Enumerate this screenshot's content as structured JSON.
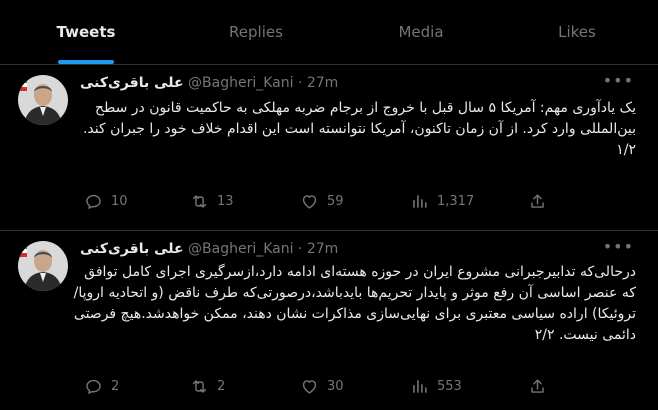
{
  "tabs": [
    {
      "label": "Tweets",
      "active": true
    },
    {
      "label": "Replies",
      "active": false
    },
    {
      "label": "Media",
      "active": false
    },
    {
      "label": "Likes",
      "active": false
    }
  ],
  "colors": {
    "background": "#000000",
    "text": "#e7e9ea",
    "muted": "#71767b",
    "accent": "#1d9bf0",
    "divider": "#2f3336"
  },
  "tweets": [
    {
      "name": "علی باقری‌کنی",
      "handle": "@Bagheri_Kani",
      "separator": "·",
      "time": "27m",
      "text": "یک یادآوری مهم: آمریکا ۵ سال قبل با خروج از برجام ضربه مهلکی به حاکمیت قانون در سطح بین‌المللی وارد کرد. از آن زمان تاکنون، آمریکا نتوانسته است این اقدام خلاف خود را جبران کند. ۱/۲",
      "replies": "10",
      "retweets": "13",
      "likes": "59",
      "views": "1,317"
    },
    {
      "name": "علی باقری‌کنی",
      "handle": "@Bagheri_Kani",
      "separator": "·",
      "time": "27m",
      "text": "درحالی‌که تدابیرجبرانی مشروع ایران در حوزه هسته‌ای ادامه دارد،ازسرگیری اجرای کامل توافق که عنصر اساسی آن رفع موثر و پایدار تحریم‌ها بایدباشد،درصورتی‌که طرف ناقض (و اتحادیه اروپا/تروئیکا) اراده سیاسی معتبری برای نهایی‌سازی مذاکرات نشان دهند، ممکن خواهدشد.هیچ فرصتی دائمی نیست. ۲/۲",
      "replies": "2",
      "retweets": "2",
      "likes": "30",
      "views": "553"
    }
  ],
  "icons": {
    "reply": "reply-icon",
    "retweet": "retweet-icon",
    "like": "heart-icon",
    "views": "views-icon",
    "share": "share-icon",
    "more": "more-icon"
  }
}
